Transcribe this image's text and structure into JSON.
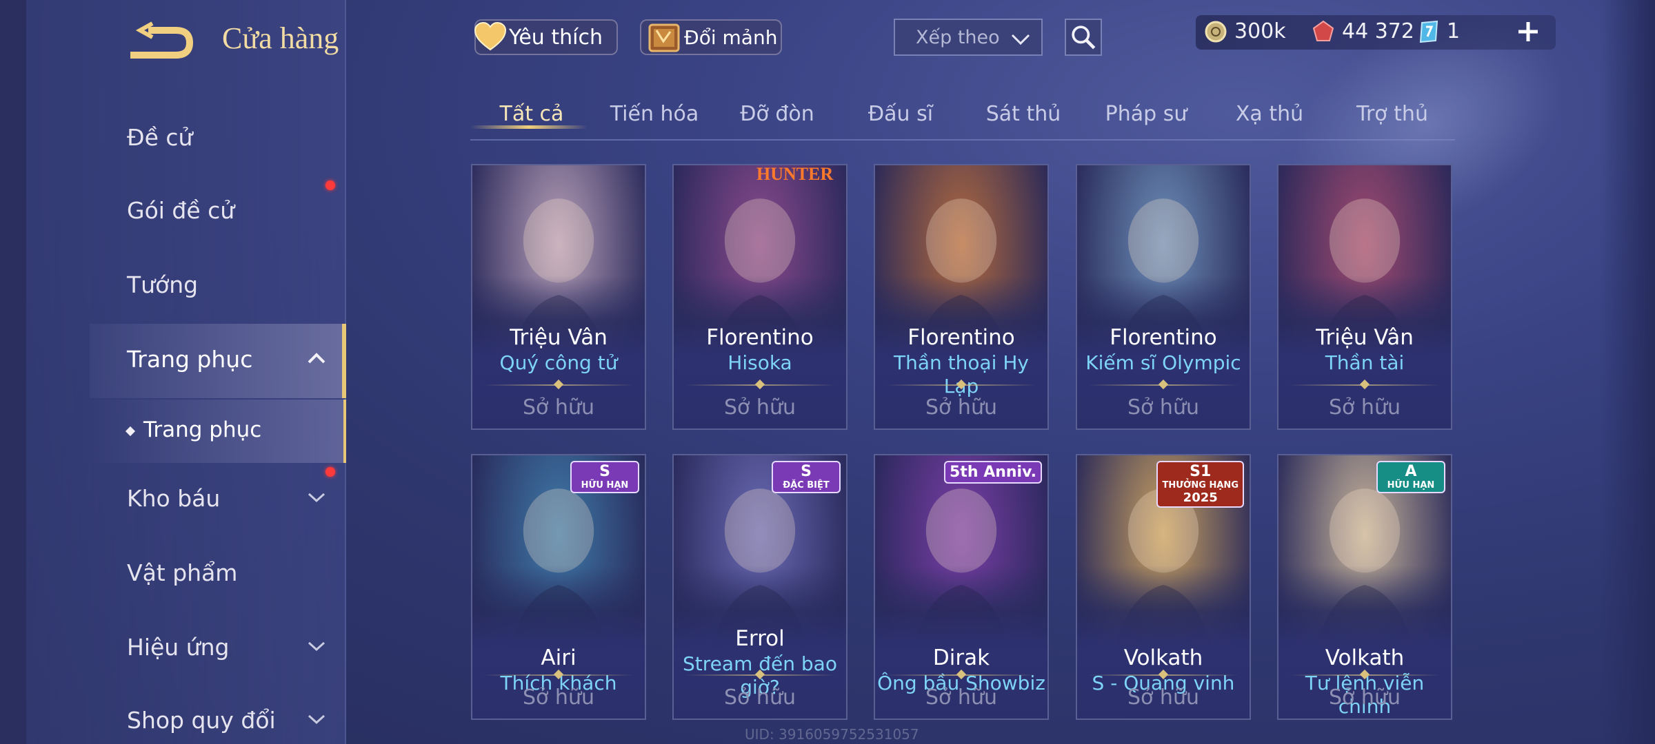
{
  "header": {
    "title": "Cửa hàng",
    "favorites_label": "Yêu thích",
    "exchange_label": "Đổi mảnh",
    "sort_label": "Xếp theo"
  },
  "currency": {
    "gold": "300k",
    "gems": "44 372",
    "tickets": "1"
  },
  "sidebar": {
    "items": [
      {
        "label": "Đề cử"
      },
      {
        "label": "Gói đề cử"
      },
      {
        "label": "Tướng"
      },
      {
        "label": "Trang phục"
      },
      {
        "label": "Kho báu"
      },
      {
        "label": "Vật phẩm"
      },
      {
        "label": "Hiệu ứng"
      },
      {
        "label": "Shop quy đổi"
      }
    ],
    "sub_item": "Trang phục"
  },
  "tabs": [
    {
      "label": "Tất cả"
    },
    {
      "label": "Tiến hóa"
    },
    {
      "label": "Đỡ đòn"
    },
    {
      "label": "Đấu sĩ"
    },
    {
      "label": "Sát thủ"
    },
    {
      "label": "Pháp sư"
    },
    {
      "label": "Xạ thủ"
    },
    {
      "label": "Trợ thủ"
    }
  ],
  "cards": [
    {
      "hero": "Triệu Vân",
      "skin": "Quý công tử",
      "status": "Sở hữu",
      "art_color": "#b9a0b8"
    },
    {
      "hero": "Florentino",
      "skin": "Hisoka",
      "status": "Sở hữu",
      "art_color": "#8a4a8c",
      "banner": "HUNTER"
    },
    {
      "hero": "Florentino",
      "skin": "Thần thoại Hy Lạp",
      "status": "Sở hữu",
      "art_color": "#b26a3e"
    },
    {
      "hero": "Florentino",
      "skin": "Kiếm sĩ Olympic",
      "status": "Sở hữu",
      "art_color": "#6d8fb8"
    },
    {
      "hero": "Triệu Vân",
      "skin": "Thần tài",
      "status": "Sở hữu",
      "art_color": "#a04a70"
    },
    {
      "hero": "Airi",
      "skin": "Thích khách",
      "status": "Sở hữu",
      "art_color": "#3f7aa8",
      "badge_tier": "S",
      "badge_text": "HỮU HẠN"
    },
    {
      "hero": "Errol",
      "skin": "Stream đến bao giờ?",
      "status": "Sở hữu",
      "art_color": "#6a6ab4",
      "badge_tier": "S",
      "badge_text": "ĐẶC BIỆT"
    },
    {
      "hero": "Dirak",
      "skin": "Ông bầu Showbiz",
      "status": "Sở hữu",
      "art_color": "#7a3ea6",
      "badge_text": "5th Anniv."
    },
    {
      "hero": "Volkath",
      "skin": "S - Quang vinh",
      "status": "Sở hữu",
      "art_color": "#c9a160",
      "badge_tier": "S1",
      "badge_text": "THƯỞNG HẠNG",
      "badge_year": "2025"
    },
    {
      "hero": "Volkath",
      "skin": "Tư lệnh viễn chinh",
      "status": "Sở hữu",
      "art_color": "#c8b59a",
      "badge_tier": "A",
      "badge_text": "HỮU HẠN"
    }
  ],
  "footer": {
    "uid": "UID: 3916059752531057"
  },
  "colors": {
    "accent_gold": "#f2cf7c",
    "skin_blue": "#7ed4f4",
    "notification_red": "#ff3a3a"
  }
}
